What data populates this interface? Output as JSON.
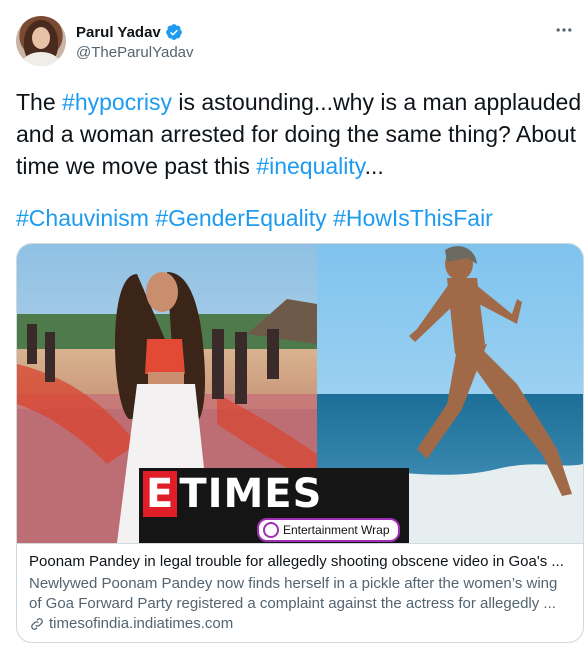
{
  "tweet": {
    "author_name": "Parul Yadav",
    "author_handle": "@TheParulYadav",
    "text_parts": [
      "The ",
      "#hypocrisy",
      " is astounding...why is a man applauded and a woman arrested for doing the same thing? About time we move past this ",
      "#inequality",
      "..."
    ],
    "hashtags_line": [
      "#Chauvinism",
      "#GenderEquality",
      "#HowIsThisFair"
    ]
  },
  "card": {
    "logo_letter": "E",
    "logo_rest": "TIMES",
    "logo_tagline": "Entertainment Wrap",
    "title": "Poonam Pandey in legal trouble for allegedly shooting obscene video in Goa's ...",
    "desc_line1": "Newlywed Poonam Pandey now finds herself in a pickle after the women’s wing",
    "desc_line2": "of Goa Forward Party registered a complaint against the actress for allegedly ...",
    "domain": "timesofindia.indiatimes.com"
  },
  "colors": {
    "hashtag": "#1d9bf0",
    "verified": "#1d9bf0",
    "secondary_text": "#536471",
    "border": "#cfd9de"
  },
  "icons": [
    "verified-badge-icon",
    "more-icon",
    "link-icon"
  ]
}
